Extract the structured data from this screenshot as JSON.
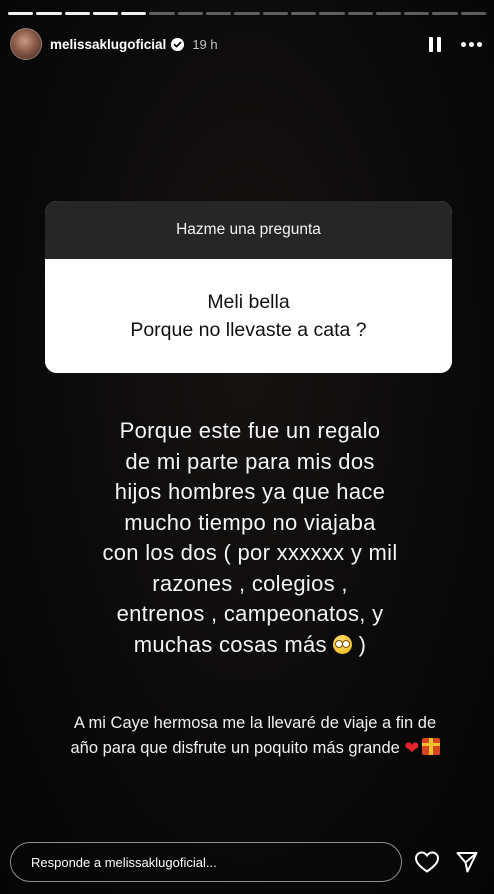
{
  "story": {
    "progress_total": 17,
    "progress_current": 5
  },
  "header": {
    "username": "melissaklugoficial",
    "verified": true,
    "time": "19 h"
  },
  "question_card": {
    "title": "Hazme una pregunta",
    "question_lines": [
      "Meli bella",
      "Porque no llevaste a cata ?"
    ]
  },
  "answer": {
    "lines": [
      "Porque  este fue un regalo",
      "de mi parte  para mis dos",
      "hijos hombres ya que hace",
      "mucho tiempo no viajaba",
      "con los dos ( por xxxxxx y mil",
      "razones ,  colegios ,",
      "entrenos , campeonatos, y",
      "muchas cosas más"
    ],
    "last_line_tail": ")"
  },
  "note": {
    "line1": "A mi Caye hermosa me la llevaré de viaje a fin de",
    "line2": "año para que disfrute  un poquito más grande"
  },
  "footer": {
    "reply_placeholder": "Responde a melissaklugoficial..."
  },
  "colors": {
    "background": "#050505",
    "card_header": "#262626",
    "card_body": "#ffffff",
    "text": "#f4f4f4"
  },
  "icons": {
    "verified": "verified-badge-icon",
    "pause": "pause-icon",
    "more": "more-options-icon",
    "like": "heart-outline-icon",
    "send": "send-icon",
    "emoji": "face-with-rolling-eyes",
    "heart_emoji": "red-heart",
    "gift_emoji": "wrapped-gift"
  }
}
